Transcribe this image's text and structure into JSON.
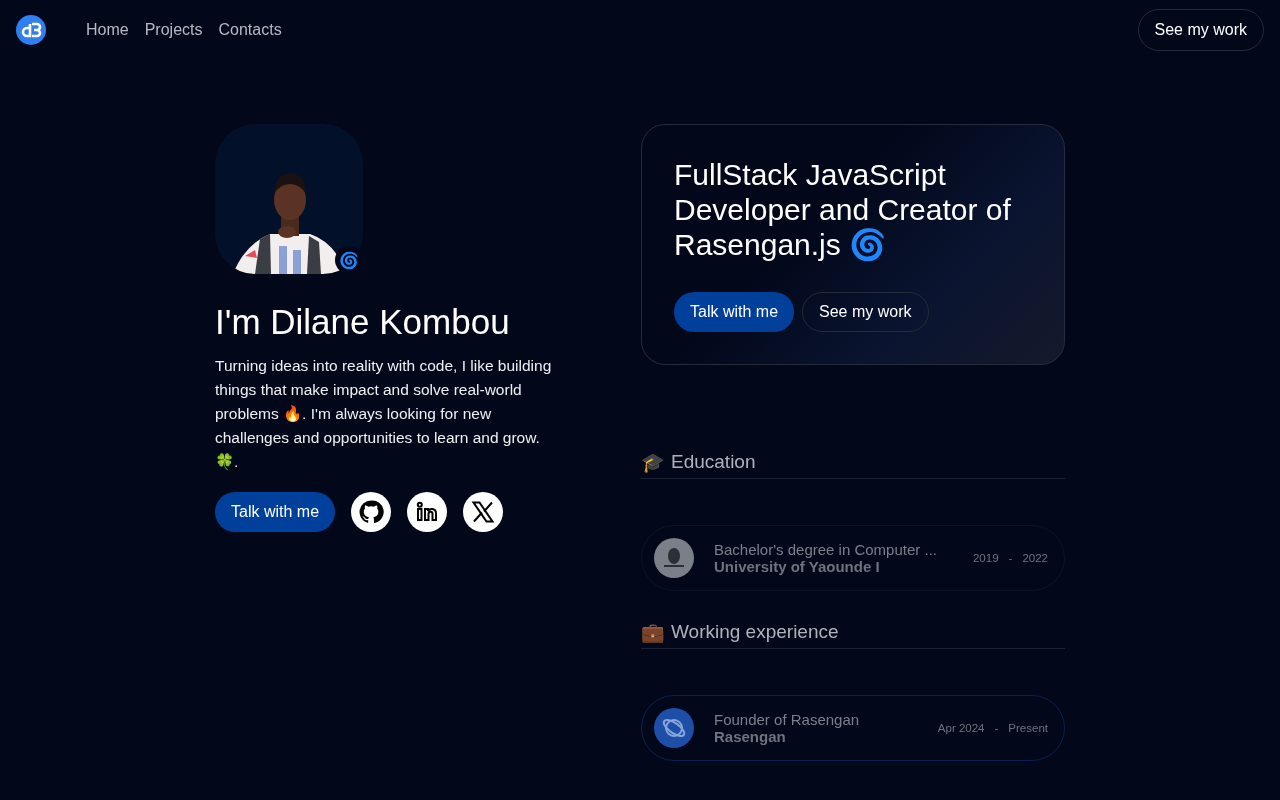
{
  "nav": {
    "links": [
      {
        "label": "Home"
      },
      {
        "label": "Projects"
      },
      {
        "label": "Contacts"
      }
    ],
    "cta": "See my work"
  },
  "profile": {
    "badge": "🌀",
    "name": "I'm Dilane Kombou",
    "bio": "Turning ideas into reality with code, I like building things that make impact and solve real-world problems 🔥. I'm always looking for new challenges and opportunities to learn and grow. 🍀.",
    "button": "Talk with me",
    "socials": [
      {
        "kind": "github"
      },
      {
        "kind": "linkedin"
      },
      {
        "kind": "x"
      }
    ]
  },
  "hero": {
    "title": "FullStack JavaScript Developer and Creator of Rasengan.js 🌀",
    "primary": "Talk with me",
    "secondary": "See my work"
  },
  "sections": [
    {
      "icon": "🎓",
      "title": "Education",
      "items": [
        {
          "kind": "university",
          "role": "Bachelor's degree in Computer ...",
          "org": "University of Yaounde I",
          "start": "2019",
          "sep": "-",
          "end": "2022"
        }
      ]
    },
    {
      "icon": "💼",
      "title": "Working experience",
      "items": [
        {
          "kind": "company",
          "role": "Founder of Rasengan",
          "org": "Rasengan",
          "start": "Apr 2024",
          "sep": "-",
          "end": "Present"
        }
      ]
    }
  ]
}
